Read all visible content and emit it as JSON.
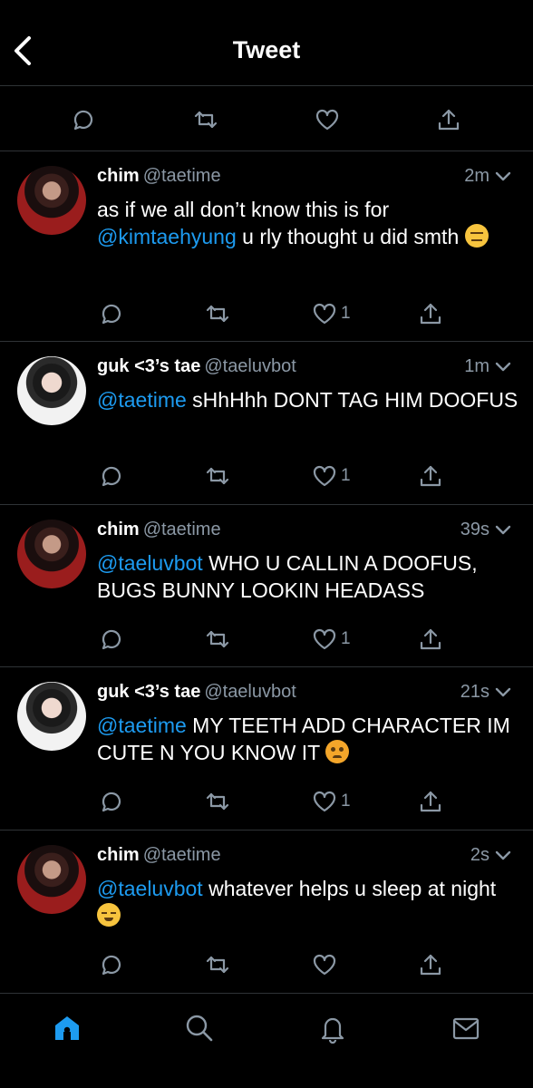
{
  "header": {
    "title": "Tweet"
  },
  "colors": {
    "accent": "#1d9bf0",
    "muted": "#8b98a5",
    "divider": "#2f3336",
    "background": "#000000"
  },
  "icons": {
    "back": "back-arrow-icon",
    "reply": "reply-icon",
    "retweet": "retweet-icon",
    "like": "heart-icon",
    "share": "share-icon",
    "caret": "chevron-down-icon",
    "home": "home-icon",
    "search": "search-icon",
    "notifications": "bell-icon",
    "messages": "mail-icon"
  },
  "tweets": [
    {
      "name": "chim",
      "handle": "@taetime",
      "time": "2m",
      "mention": "@kimtaehyung",
      "pre_text": "as if we all don’t know this is for",
      "post_text": "u rly thought u did smth",
      "emoji": "expressionless-face-emoji",
      "likes": "1"
    },
    {
      "name": "guk <3’s tae",
      "handle": "@taeluvbot",
      "time": "1m",
      "mention": "@taetime",
      "text": "sHhHhh DONT TAG HIM DOOFUS",
      "likes": "1"
    },
    {
      "name": "chim",
      "handle": "@taetime",
      "time": "39s",
      "mention": "@taeluvbot",
      "text": "WHO U CALLIN A DOOFUS, BUGS BUNNY LOOKIN HEADASS",
      "likes": "1"
    },
    {
      "name": "guk <3’s tae",
      "handle": "@taeluvbot",
      "time": "21s",
      "mention": "@taetime",
      "text": "MY TEETH ADD CHARACTER IM CUTE N YOU KNOW IT",
      "emoji": "angry-face-emoji",
      "likes": "1"
    },
    {
      "name": "chim",
      "handle": "@taetime",
      "time": "2s",
      "mention": "@taeluvbot",
      "text": "whatever helps u sleep at night",
      "emoji": "relieved-face-emoji"
    }
  ]
}
